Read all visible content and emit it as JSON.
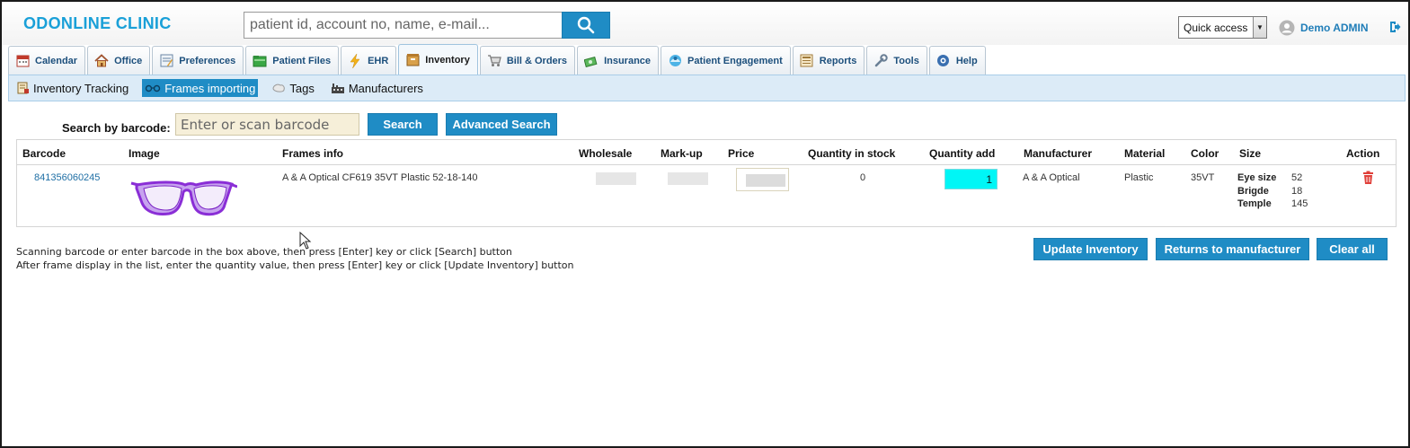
{
  "header": {
    "brand": "ODONLINE CLINIC",
    "search_placeholder": "patient id, account no, name, e-mail...",
    "quick_access": "Quick access",
    "user_name": "Demo ADMIN",
    "icons": {
      "search": "search-icon",
      "user": "user-icon",
      "logout": "logout-icon"
    }
  },
  "tabs": [
    {
      "label": "Calendar",
      "icon": "calendar-icon",
      "color": "#c0392b"
    },
    {
      "label": "Office",
      "icon": "home-icon",
      "color": "#c98a2b"
    },
    {
      "label": "Preferences",
      "icon": "preferences-icon",
      "color": "#4a79a8"
    },
    {
      "label": "Patient Files",
      "icon": "folder-icon",
      "color": "#2f9e3a"
    },
    {
      "label": "EHR",
      "icon": "lightning-icon",
      "color": "#f2b21b"
    },
    {
      "label": "Inventory",
      "icon": "box-icon",
      "color": "#c98a2b",
      "active": true
    },
    {
      "label": "Bill & Orders",
      "icon": "cart-icon",
      "color": "#777777"
    },
    {
      "label": "Insurance",
      "icon": "money-icon",
      "color": "#3a9e4a"
    },
    {
      "label": "Patient Engagement",
      "icon": "engagement-icon",
      "color": "#1f8cc5"
    },
    {
      "label": "Reports",
      "icon": "reports-icon",
      "color": "#c98a2b"
    },
    {
      "label": "Tools",
      "icon": "wrench-icon",
      "color": "#6a7f95"
    },
    {
      "label": "Help",
      "icon": "help-icon",
      "color": "#3a6fb0"
    }
  ],
  "subnav": [
    {
      "label": "Inventory Tracking",
      "icon": "tracking-icon"
    },
    {
      "label": "Frames importing",
      "icon": "glasses-icon",
      "active": true
    },
    {
      "label": "Tags",
      "icon": "tags-icon"
    },
    {
      "label": "Manufacturers",
      "icon": "factory-icon"
    }
  ],
  "search": {
    "label": "Search by barcode:",
    "placeholder": "Enter or scan barcode",
    "search_button": "Search",
    "advanced_button": "Advanced Search"
  },
  "table": {
    "columns": [
      "Barcode",
      "Image",
      "Frames info",
      "Wholesale",
      "Mark-up",
      "Price",
      "Quantity in stock",
      "Quantity add",
      "Manufacturer",
      "Material",
      "Color",
      "Size",
      "Action"
    ],
    "row": {
      "barcode": "841356060245",
      "frames_info": "A & A Optical CF619 35VT Plastic 52-18-140",
      "quantity_in_stock": "0",
      "quantity_add": "1",
      "manufacturer": "A & A Optical",
      "material": "Plastic",
      "color": "35VT",
      "size": [
        {
          "key": "Eye size",
          "value": "52"
        },
        {
          "key": "Brigde",
          "value": "18"
        },
        {
          "key": "Temple",
          "value": "145"
        }
      ],
      "action_icon": "trash-icon"
    }
  },
  "info": {
    "line1": "Scanning barcode or enter barcode in the box above, then press [Enter] key or click [Search] button",
    "line2": "After frame display in the list, enter the quantity value, then press [Enter] key or click [Update Inventory] button"
  },
  "actions": {
    "update": "Update Inventory",
    "returns": "Returns to manufacturer",
    "clear": "Clear all"
  },
  "colors": {
    "accent": "#1f8cc5",
    "brand": "#1aa0d8",
    "qty_highlight": "#00f6f6",
    "glasses": "#9b3de0"
  }
}
